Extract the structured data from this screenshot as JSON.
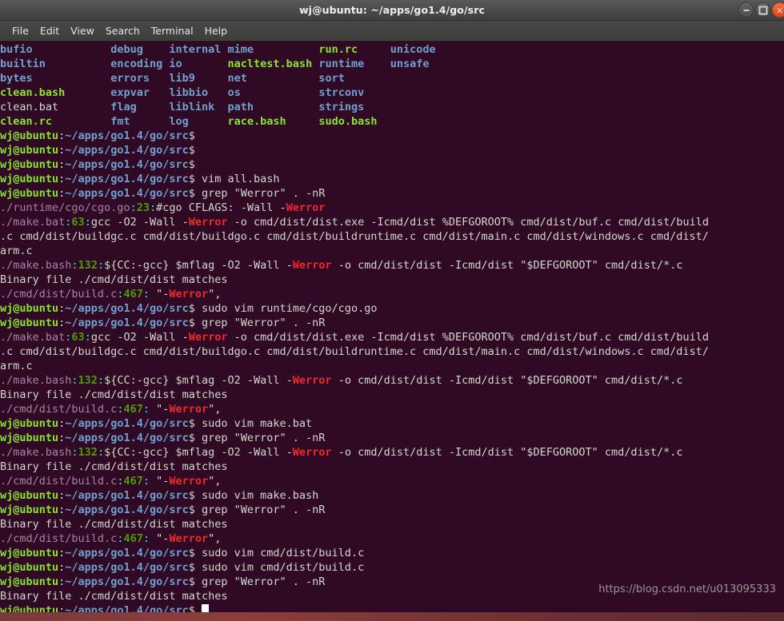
{
  "window": {
    "title": "wj@ubuntu: ~/apps/go1.4/go/src",
    "controls": {
      "minimize": "minimize",
      "maximize": "maximize",
      "close": "×"
    }
  },
  "menubar": {
    "items": [
      "File",
      "Edit",
      "View",
      "Search",
      "Terminal",
      "Help"
    ]
  },
  "colors": {
    "background": "#300a24",
    "foreground": "#d3d7cf",
    "prompt_user": "#8ae234",
    "prompt_path": "#729fcf",
    "directory": "#729fcf",
    "executable": "#8ae234",
    "grep_filename": "#ad7fa8",
    "grep_lineno": "#4e9a06",
    "grep_separator": "#34e2e2",
    "grep_match": "#ef2929",
    "titlebar": "#484846",
    "close_button": "#d94715"
  },
  "terminal": {
    "prompt": {
      "user_host": "wj@ubuntu",
      "colon": ":",
      "path": "~/apps/go1.4/go/src",
      "sigil": "$"
    },
    "file_listing": {
      "columns": [
        {
          "entries": [
            {
              "name": "bufio",
              "type": "directory"
            },
            {
              "name": "builtin",
              "type": "directory"
            },
            {
              "name": "bytes",
              "type": "directory"
            },
            {
              "name": "clean.bash",
              "type": "executable"
            },
            {
              "name": "clean.bat",
              "type": "file"
            },
            {
              "name": "clean.rc",
              "type": "executable"
            }
          ]
        },
        {
          "entries": [
            {
              "name": "debug",
              "type": "directory"
            },
            {
              "name": "encoding",
              "type": "directory"
            },
            {
              "name": "errors",
              "type": "directory"
            },
            {
              "name": "expvar",
              "type": "directory"
            },
            {
              "name": "flag",
              "type": "directory"
            },
            {
              "name": "fmt",
              "type": "directory"
            }
          ]
        },
        {
          "entries": [
            {
              "name": "internal",
              "type": "directory"
            },
            {
              "name": "io",
              "type": "directory"
            },
            {
              "name": "lib9",
              "type": "directory"
            },
            {
              "name": "libbio",
              "type": "directory"
            },
            {
              "name": "liblink",
              "type": "directory"
            },
            {
              "name": "log",
              "type": "directory"
            }
          ]
        },
        {
          "entries": [
            {
              "name": "mime",
              "type": "directory"
            },
            {
              "name": "nacltest.bash",
              "type": "executable"
            },
            {
              "name": "net",
              "type": "directory"
            },
            {
              "name": "os",
              "type": "directory"
            },
            {
              "name": "path",
              "type": "directory"
            },
            {
              "name": "race.bash",
              "type": "executable"
            }
          ]
        },
        {
          "entries": [
            {
              "name": "run.rc",
              "type": "executable"
            },
            {
              "name": "runtime",
              "type": "directory"
            },
            {
              "name": "sort",
              "type": "directory"
            },
            {
              "name": "strconv",
              "type": "directory"
            },
            {
              "name": "strings",
              "type": "directory"
            },
            {
              "name": "sudo.bash",
              "type": "executable"
            }
          ]
        },
        {
          "entries": [
            {
              "name": "unicode",
              "type": "directory"
            },
            {
              "name": "unsafe",
              "type": "directory"
            }
          ]
        }
      ]
    },
    "lines": [
      {
        "kind": "listing_row",
        "row": 0
      },
      {
        "kind": "listing_row",
        "row": 1
      },
      {
        "kind": "listing_row",
        "row": 2
      },
      {
        "kind": "listing_row",
        "row": 3
      },
      {
        "kind": "listing_row",
        "row": 4
      },
      {
        "kind": "listing_row",
        "row": 5
      },
      {
        "kind": "prompt",
        "command": ""
      },
      {
        "kind": "prompt",
        "command": ""
      },
      {
        "kind": "prompt",
        "command": ""
      },
      {
        "kind": "prompt",
        "command": "vim all.bash"
      },
      {
        "kind": "prompt",
        "command": "grep \"Werror\" . -nR"
      },
      {
        "kind": "grep",
        "file": "./runtime/cgo/cgo.go",
        "lineno": "23",
        "pre": "#cgo CFLAGS: -Wall -",
        "match": "Werror",
        "post": ""
      },
      {
        "kind": "grep",
        "file": "./make.bat",
        "lineno": "63",
        "pre": "gcc -O2 -Wall -",
        "match": "Werror",
        "post": " -o cmd/dist/dist.exe -Icmd/dist %DEFGOROOT% cmd/dist/buf.c cmd/dist/build"
      },
      {
        "kind": "plain",
        "text": ".c cmd/dist/buildgc.c cmd/dist/buildgo.c cmd/dist/buildruntime.c cmd/dist/main.c cmd/dist/windows.c cmd/dist/"
      },
      {
        "kind": "plain",
        "text": "arm.c"
      },
      {
        "kind": "grep",
        "file": "./make.bash",
        "lineno": "132",
        "pre": "${CC:-gcc} $mflag -O2 -Wall -",
        "match": "Werror",
        "post": " -o cmd/dist/dist -Icmd/dist \"$DEFGOROOT\" cmd/dist/*.c"
      },
      {
        "kind": "plain",
        "text": "Binary file ./cmd/dist/dist matches"
      },
      {
        "kind": "grep",
        "file": "./cmd/dist/build.c",
        "lineno": "467",
        "pre": " \"-",
        "match": "Werror",
        "post": "\","
      },
      {
        "kind": "prompt",
        "command": "sudo vim runtime/cgo/cgo.go"
      },
      {
        "kind": "prompt",
        "command": "grep \"Werror\" . -nR"
      },
      {
        "kind": "grep",
        "file": "./make.bat",
        "lineno": "63",
        "pre": "gcc -O2 -Wall -",
        "match": "Werror",
        "post": " -o cmd/dist/dist.exe -Icmd/dist %DEFGOROOT% cmd/dist/buf.c cmd/dist/build"
      },
      {
        "kind": "plain",
        "text": ".c cmd/dist/buildgc.c cmd/dist/buildgo.c cmd/dist/buildruntime.c cmd/dist/main.c cmd/dist/windows.c cmd/dist/"
      },
      {
        "kind": "plain",
        "text": "arm.c"
      },
      {
        "kind": "grep",
        "file": "./make.bash",
        "lineno": "132",
        "pre": "${CC:-gcc} $mflag -O2 -Wall -",
        "match": "Werror",
        "post": " -o cmd/dist/dist -Icmd/dist \"$DEFGOROOT\" cmd/dist/*.c"
      },
      {
        "kind": "plain",
        "text": "Binary file ./cmd/dist/dist matches"
      },
      {
        "kind": "grep",
        "file": "./cmd/dist/build.c",
        "lineno": "467",
        "pre": " \"-",
        "match": "Werror",
        "post": "\","
      },
      {
        "kind": "prompt",
        "command": "sudo vim make.bat"
      },
      {
        "kind": "prompt",
        "command": "grep \"Werror\" . -nR"
      },
      {
        "kind": "grep",
        "file": "./make.bash",
        "lineno": "132",
        "pre": "${CC:-gcc} $mflag -O2 -Wall -",
        "match": "Werror",
        "post": " -o cmd/dist/dist -Icmd/dist \"$DEFGOROOT\" cmd/dist/*.c"
      },
      {
        "kind": "plain",
        "text": "Binary file ./cmd/dist/dist matches"
      },
      {
        "kind": "grep",
        "file": "./cmd/dist/build.c",
        "lineno": "467",
        "pre": " \"-",
        "match": "Werror",
        "post": "\","
      },
      {
        "kind": "prompt",
        "command": "sudo vim make.bash"
      },
      {
        "kind": "prompt",
        "command": "grep \"Werror\" . -nR"
      },
      {
        "kind": "plain",
        "text": "Binary file ./cmd/dist/dist matches"
      },
      {
        "kind": "grep",
        "file": "./cmd/dist/build.c",
        "lineno": "467",
        "pre": " \"-",
        "match": "Werror",
        "post": "\","
      },
      {
        "kind": "prompt",
        "command": "sudo vim cmd/dist/build.c"
      },
      {
        "kind": "prompt",
        "command": "sudo vim cmd/dist/build.c"
      },
      {
        "kind": "prompt",
        "command": "grep \"Werror\" . -nR"
      },
      {
        "kind": "plain",
        "text": "Binary file ./cmd/dist/dist matches"
      },
      {
        "kind": "prompt_cursor",
        "command": ""
      }
    ]
  },
  "watermark": {
    "text": "https://blog.csdn.net/u013095333"
  }
}
